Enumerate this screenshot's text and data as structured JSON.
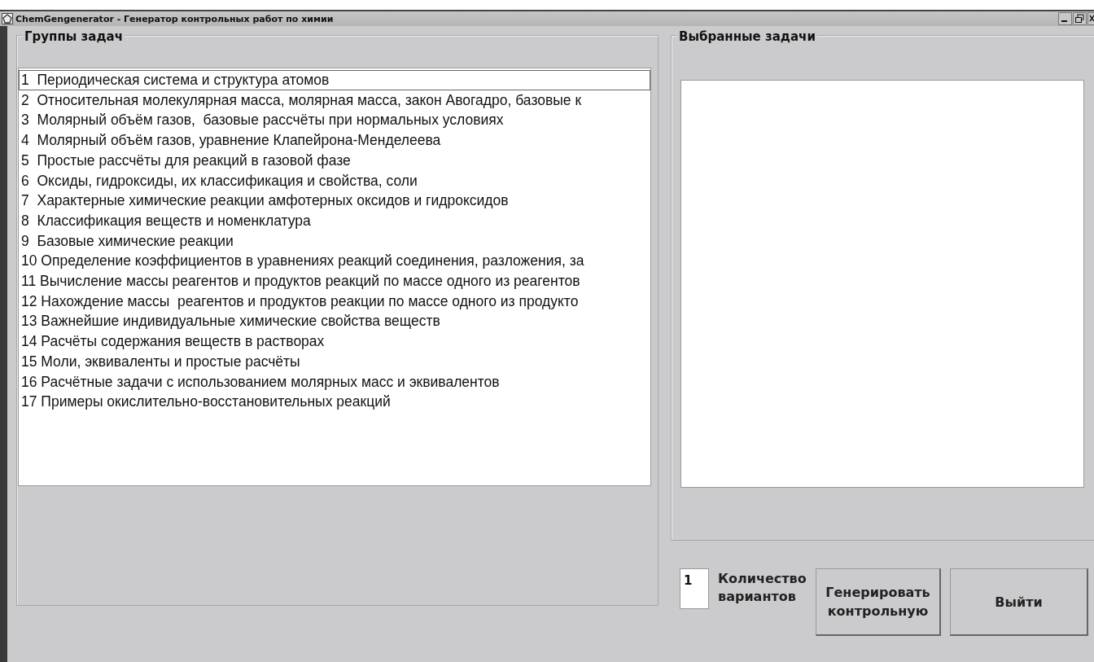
{
  "window": {
    "title": "ChemGengenerator  - Генератор контрольных работ по химии"
  },
  "groups": {
    "title": "Группы задач",
    "items": [
      {
        "label": "1  Периодическая система и структура атомов",
        "selected": true
      },
      {
        "label": "2  Относительная молекулярная масса, молярная масса, закон Авогадро, базовые к",
        "selected": false
      },
      {
        "label": "3  Молярный объём газов,  базовые рассчёты при нормальных условиях",
        "selected": false
      },
      {
        "label": "4  Молярный объём газов, уравнение Клапейрона-Менделеева",
        "selected": false
      },
      {
        "label": "5  Простые рассчёты для реакций в газовой фазе",
        "selected": false
      },
      {
        "label": "6  Оксиды, гидроксиды, их классификация и свойства, соли",
        "selected": false
      },
      {
        "label": "7  Характерные химические реакции амфотерных оксидов и гидроксидов",
        "selected": false
      },
      {
        "label": "8  Классификация веществ и номенклатура",
        "selected": false
      },
      {
        "label": "9  Базовые химические реакции",
        "selected": false
      },
      {
        "label": "10 Определение коэффициентов в уравнениях реакций соединения, разложения, за",
        "selected": false
      },
      {
        "label": "11 Вычисление массы реагентов и продуктов реакций по массе одного из реагентов",
        "selected": false
      },
      {
        "label": "12 Нахождение массы  реагентов и продуктов реакции по массе одного из продукто",
        "selected": false
      },
      {
        "label": "13 Важнейшие индивидуальные химические свойства веществ",
        "selected": false
      },
      {
        "label": "14 Расчёты содержания веществ в растворах",
        "selected": false
      },
      {
        "label": "15 Моли, эквиваленты и простые расчёты",
        "selected": false
      },
      {
        "label": "16 Расчётные задачи с использованием молярных масс и эквивалентов",
        "selected": false
      },
      {
        "label": "17 Примеры окислительно-восстановительных реакций",
        "selected": false
      }
    ]
  },
  "selected_tasks": {
    "title": "Выбранные задачи"
  },
  "variants": {
    "value": "1",
    "label": "Количество вариантов"
  },
  "buttons": [
    "Генерировать контрольную",
    "Выйти"
  ]
}
